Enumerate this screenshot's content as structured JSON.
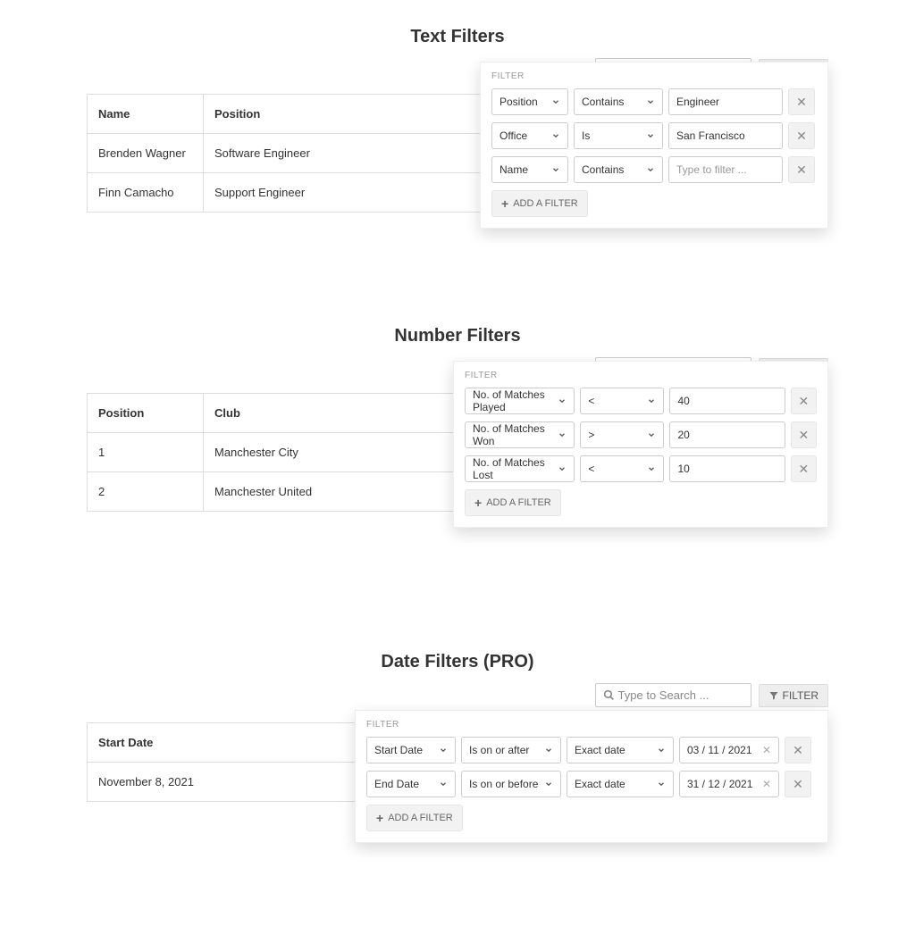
{
  "common": {
    "search_placeholder": "Type to Search ...",
    "filter_btn": "FILTER",
    "filter_panel_label": "FILTER",
    "add_filter": "ADD A FILTER"
  },
  "text_section": {
    "title": "Text Filters",
    "table": {
      "headers": [
        "Name",
        "Position"
      ],
      "rows": [
        [
          "Brenden Wagner",
          "Software Engineer"
        ],
        [
          "Finn Camacho",
          "Support Engineer"
        ]
      ]
    },
    "filters": [
      {
        "field": "Position",
        "op": "Contains",
        "value": "Engineer",
        "placeholder": ""
      },
      {
        "field": "Office",
        "op": "Is",
        "value": "San Francisco",
        "placeholder": ""
      },
      {
        "field": "Name",
        "op": "Contains",
        "value": "",
        "placeholder": "Type to filter ..."
      }
    ]
  },
  "number_section": {
    "title": "Number Filters",
    "table": {
      "headers": [
        "Position",
        "Club"
      ],
      "rows": [
        [
          "1",
          "Manchester City"
        ],
        [
          "2",
          "Manchester United"
        ]
      ]
    },
    "filters": [
      {
        "field": "No. of Matches Played",
        "op": "<",
        "value": "40"
      },
      {
        "field": "No. of Matches Won",
        "op": ">",
        "value": "20"
      },
      {
        "field": "No. of Matches Lost",
        "op": "<",
        "value": "10"
      }
    ]
  },
  "date_section": {
    "title": "Date Filters (PRO)",
    "table": {
      "headers": [
        "Start Date"
      ],
      "rows": [
        [
          "November 8, 2021"
        ]
      ]
    },
    "filters": [
      {
        "field": "Start Date",
        "op": "Is on or after",
        "type": "Exact date",
        "value": "03 / 11 / 2021"
      },
      {
        "field": "End Date",
        "op": "Is on or before",
        "type": "Exact date",
        "value": "31 / 12 / 2021"
      }
    ]
  }
}
